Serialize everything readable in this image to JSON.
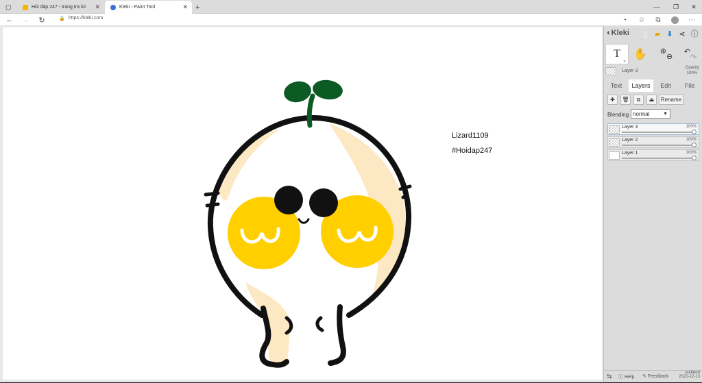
{
  "browser": {
    "tabs": [
      {
        "title": "Hỏi đáp 247 - trang tra loi",
        "active": false
      },
      {
        "title": "Kleki - Paint Tool",
        "active": true
      }
    ],
    "new_tab_symbol": "+",
    "url": "https://kleki.com",
    "window_controls": [
      "—",
      "❐",
      "✕"
    ]
  },
  "canvas": {
    "text_lines": [
      "Lizard1109",
      "#Hoidap247"
    ],
    "colors": {
      "outline": "#111111",
      "skin": "#fde8c4",
      "cheek": "#ffcf00",
      "sprout": "#0c5a24"
    }
  },
  "panel": {
    "logo": "Kleki",
    "current_layer": "Layer 3",
    "opacity_label": "Opacity",
    "opacity_value": "100%",
    "tabs": [
      "Text",
      "Layers",
      "Edit",
      "File"
    ],
    "active_tab": "Layers",
    "rename_label": "Rename",
    "blending_label": "Blending",
    "blending_value": "normal",
    "layers": [
      {
        "name": "Layer 3",
        "opacity": "100%",
        "active": true
      },
      {
        "name": "Layer 2",
        "opacity": "100%",
        "active": false
      },
      {
        "name": "Layer 1",
        "opacity": "100%",
        "active": false
      }
    ],
    "footer": {
      "help": "Help",
      "feedback": "Feedback",
      "updated_label": "updated",
      "updated_date": "2021-12-13"
    }
  }
}
